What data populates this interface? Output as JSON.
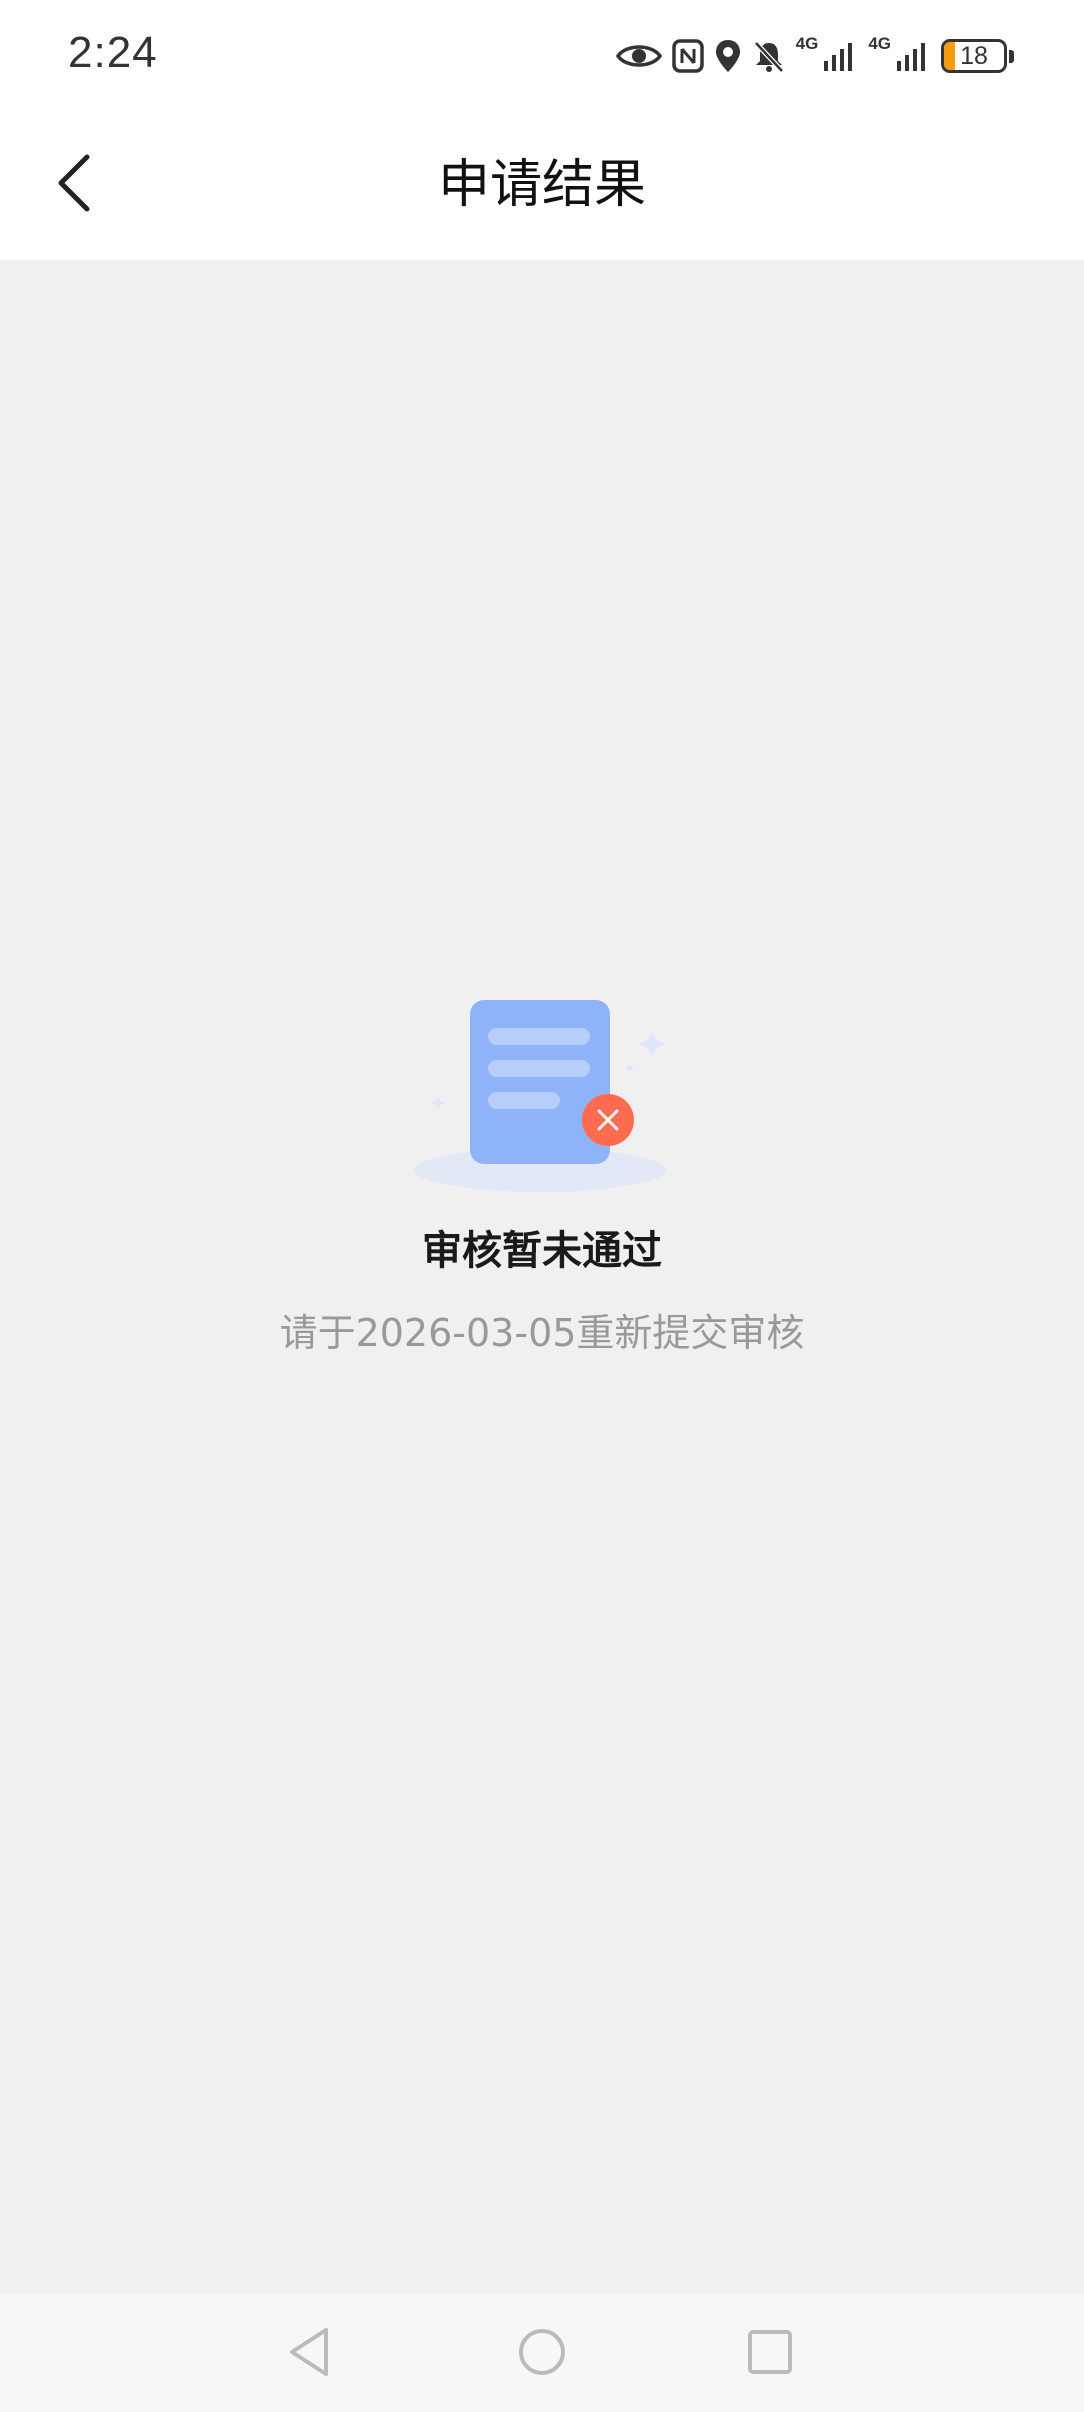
{
  "status_bar": {
    "time": "2:24",
    "icons": [
      "eye-icon",
      "nfc-icon",
      "location-icon",
      "bell-off-icon",
      "signal-4g-icon",
      "signal-4g-icon"
    ],
    "network_label_1": "4G",
    "network_label_2": "4G",
    "battery_level": "18",
    "battery_fraction": 0.18,
    "battery_color": "#f39c12"
  },
  "header": {
    "title": "申请结果",
    "back_icon": "chevron-left-icon"
  },
  "result": {
    "illustration": "document-rejected-icon",
    "title": "审核暂未通过",
    "subtitle": "请于2026-03-05重新提交审核",
    "accent_color": "#8fb3f9",
    "error_color": "#ff6b4f"
  },
  "system_nav": {
    "back_icon": "triangle-back-icon",
    "home_icon": "circle-home-icon",
    "recents_icon": "square-recents-icon"
  }
}
